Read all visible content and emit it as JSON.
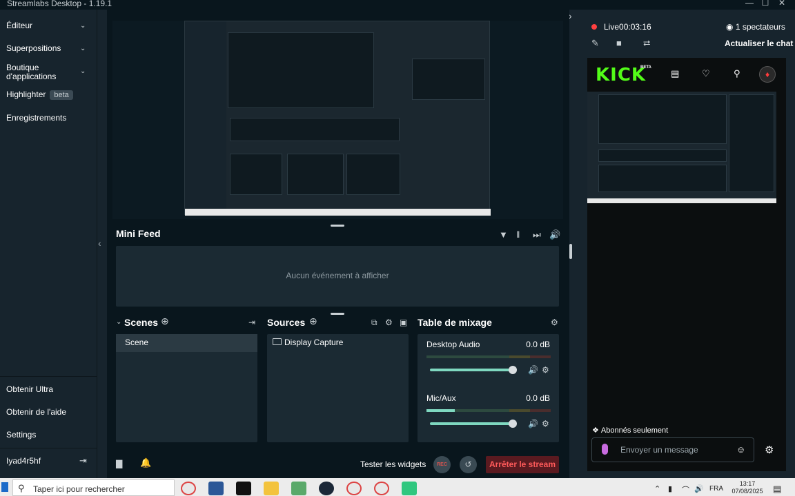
{
  "window": {
    "title": "Streamlabs Desktop - 1.19.1",
    "controls": {
      "minimize": "—",
      "maximize": "☐",
      "close": "✕"
    }
  },
  "sidebar": {
    "items": [
      {
        "label": "Éditeur",
        "has_chevron": true
      },
      {
        "label": "Superpositions",
        "has_chevron": true
      },
      {
        "label": "Boutique d'applications",
        "line1": "Boutique",
        "line2": "d'applications",
        "has_chevron": true
      },
      {
        "label": "Highlighter",
        "badge": "beta"
      },
      {
        "label": "Enregistrements"
      }
    ],
    "bottom_items": [
      {
        "label": "Obtenir Ultra"
      },
      {
        "label": "Obtenir de l'aide"
      },
      {
        "label": "Settings"
      }
    ],
    "user": {
      "name": "Iyad4r5hf"
    }
  },
  "mini_feed": {
    "title": "Mini Feed",
    "empty_text": "Aucun événement à afficher"
  },
  "scenes": {
    "title": "Scenes",
    "items": [
      {
        "name": "Scene",
        "selected": true
      }
    ]
  },
  "sources": {
    "title": "Sources",
    "items": [
      {
        "name": "Display Capture",
        "icon": "monitor-icon"
      }
    ]
  },
  "mixer": {
    "title": "Table de mixage",
    "channels": [
      {
        "name": "Desktop Audio",
        "db": "0.0 dB",
        "level": 0.0,
        "volume": 1.0
      },
      {
        "name": "Mic/Aux",
        "db": "0.0 dB",
        "level": 0.23,
        "volume": 1.0
      }
    ]
  },
  "footer": {
    "test_widgets": "Tester les widgets",
    "rec_label": "REC",
    "stop_stream": "Arrêter le stream"
  },
  "right_panel": {
    "live_label": "Live",
    "live_time": "00:03:16",
    "viewers": "1 spectateurs",
    "refresh_chat": "Actualiser le chat",
    "kick": {
      "logo": "KICK",
      "beta": "BETA",
      "subs_only": "Abonnés seulement",
      "chat_placeholder": "Envoyer un message"
    }
  },
  "taskbar": {
    "search_placeholder": "Taper ici pour rechercher",
    "language": "FRA",
    "time": "13:17",
    "date": "07/08/2025"
  },
  "colors": {
    "background": "#17242d",
    "panel": "#1b2a33",
    "accent_green": "#53fc18",
    "mixer_accent": "#7fd8c0",
    "live_red": "#ff4040",
    "stop_red": "#ff5a5a"
  }
}
